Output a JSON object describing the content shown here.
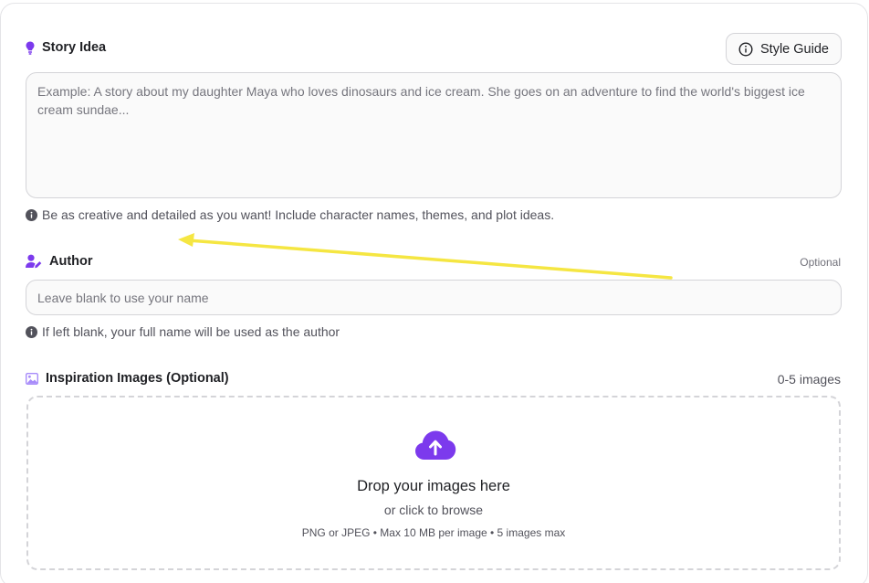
{
  "story_idea": {
    "label": "Story Idea",
    "icon": "lightbulb-icon",
    "style_guide_label": "Style Guide",
    "placeholder": "Example: A story about my daughter Maya who loves dinosaurs and ice cream. She goes on an adventure to find the world's biggest ice cream sundae...",
    "helper": "Be as creative and detailed as you want! Include character names, themes, and plot ideas."
  },
  "author": {
    "label": "Author",
    "icon": "user-pen-icon",
    "optional_label": "Optional",
    "placeholder": "Leave blank to use your name",
    "helper": "If left blank, your full name will be used as the author"
  },
  "inspiration": {
    "label": "Inspiration Images (Optional)",
    "icon": "image-icon",
    "count_label": "0-5 images",
    "dropzone_title": "Drop your images here",
    "dropzone_subtitle": "or click to browse",
    "dropzone_formats": "PNG or JPEG • Max 10 MB per image • 5 images max"
  },
  "colors": {
    "accent": "#7c3aed",
    "annotation": "#f5e642"
  }
}
